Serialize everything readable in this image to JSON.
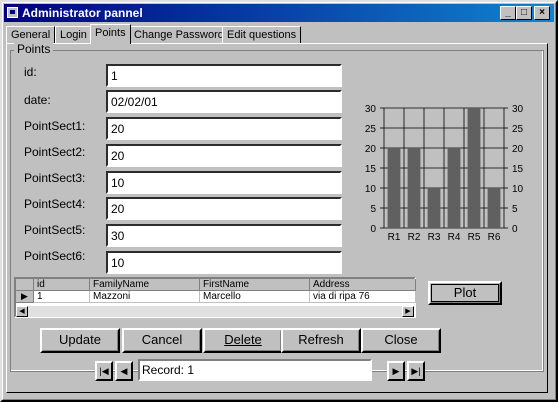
{
  "window": {
    "title": "Administrator pannel",
    "controls": {
      "minimize": "_",
      "maximize": "□",
      "close": "×"
    }
  },
  "tabs": [
    "General",
    "Login",
    "Points",
    "Change Password",
    "Edit questions"
  ],
  "active_tab": "Points",
  "group": {
    "label": "Points"
  },
  "fields": [
    {
      "label": "id:",
      "value": "1"
    },
    {
      "label": "date:",
      "value": "02/02/01"
    },
    {
      "label": "PointSect1:",
      "value": "20"
    },
    {
      "label": "PointSect2:",
      "value": "20"
    },
    {
      "label": "PointSect3:",
      "value": "10"
    },
    {
      "label": "PointSect4:",
      "value": "20"
    },
    {
      "label": "PointSect5:",
      "value": "30"
    },
    {
      "label": "PointSect6:",
      "value": "10"
    }
  ],
  "chart_data": {
    "type": "bar",
    "categories": [
      "R1",
      "R2",
      "R3",
      "R4",
      "R5",
      "R6"
    ],
    "values": [
      20,
      20,
      10,
      20,
      30,
      10
    ],
    "ylim": [
      0,
      30
    ],
    "yticks": [
      0,
      5,
      10,
      15,
      20,
      25,
      30
    ],
    "grid": true,
    "bar_color": "#606060"
  },
  "table": {
    "columns": [
      "id",
      "FamilyName",
      "FirstName",
      "Address"
    ],
    "rows": [
      [
        "1",
        "Mazzoni",
        "Marcello",
        "via di ripa 76"
      ]
    ],
    "row_indicator": "▶"
  },
  "buttons": {
    "plot": "Plot",
    "update": "Update",
    "cancel": "Cancel",
    "delete": "Delete",
    "refresh": "Refresh",
    "close": "Close"
  },
  "navigator": {
    "first": "|◀",
    "prev": "◀",
    "next": "▶",
    "last": "▶|",
    "record_text": "Record: 1"
  }
}
